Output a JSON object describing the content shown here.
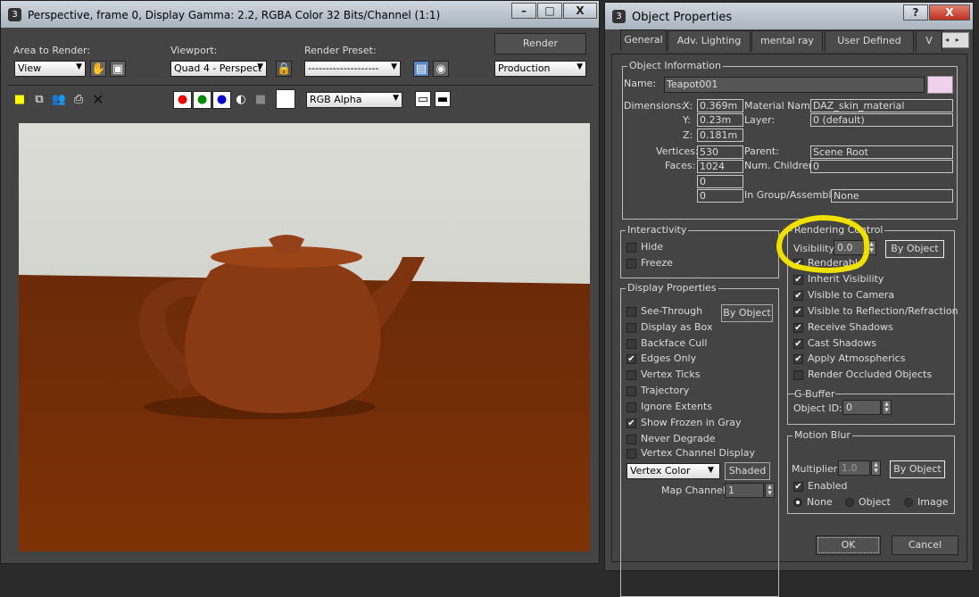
{
  "render_window": {
    "title": "Perspective, frame 0, Display Gamma: 2.2, RGBA Color 32 Bits/Channel (1:1)",
    "area_to_render_label": "Area to Render:",
    "area_to_render_value": "View",
    "viewport_label": "Viewport:",
    "viewport_value": "Quad 4 - Perspect",
    "render_preset_label": "Render Preset:",
    "render_preset_value": "--------------------",
    "render_button": "Render",
    "render_mode_value": "Production",
    "channel_value": "RGB Alpha",
    "colors": {
      "floor": "#7a2e06",
      "background": "#d8d8d2",
      "teapot": "#8a3a12"
    }
  },
  "dialog": {
    "title": "Object Properties",
    "tabs": [
      "General",
      "Adv. Lighting",
      "mental ray",
      "User Defined",
      "V"
    ],
    "object_info": {
      "title": "Object Information",
      "name_label": "Name:",
      "name_value": "Teapot001",
      "color_swatch": "#f0d0ec",
      "dimensions_label": "Dimensions:",
      "x_label": "X:",
      "x": "0.369m",
      "y_label": "Y:",
      "y": "0.23m",
      "z_label": "Z:",
      "z": "0.181m",
      "vertices_label": "Vertices:",
      "vertices": "530",
      "faces_label": "Faces:",
      "faces": "1024",
      "extra1": "0",
      "extra2": "0",
      "material_label": "Material Name:",
      "material": "DAZ_skin_material",
      "layer_label": "Layer:",
      "layer": "0 (default)",
      "parent_label": "Parent:",
      "parent": "Scene Root",
      "children_label": "Num. Children:",
      "children": "0",
      "group_label": "In Group/Assembly:",
      "group": "None"
    },
    "interactivity": {
      "title": "Interactivity",
      "items": [
        {
          "label": "Hide",
          "checked": false
        },
        {
          "label": "Freeze",
          "checked": false
        }
      ]
    },
    "display_properties": {
      "title": "Display Properties",
      "by_object": "By Object",
      "items": [
        {
          "label": "See-Through",
          "checked": false
        },
        {
          "label": "Display as Box",
          "checked": false
        },
        {
          "label": "Backface Cull",
          "checked": false
        },
        {
          "label": "Edges Only",
          "checked": true
        },
        {
          "label": "Vertex Ticks",
          "checked": false
        },
        {
          "label": "Trajectory",
          "checked": false
        },
        {
          "label": "Ignore Extents",
          "checked": false
        },
        {
          "label": "Show Frozen in Gray",
          "checked": true
        },
        {
          "label": "Never Degrade",
          "checked": false
        },
        {
          "label": "Vertex Channel Display",
          "checked": false
        }
      ],
      "vertex_color_value": "Vertex Color",
      "shaded_button": "Shaded",
      "map_channel_label": "Map Channel:",
      "map_channel": "1"
    },
    "rendering_control": {
      "title": "Rendering Control",
      "visibility_label": "Visibility:",
      "visibility": "0.0",
      "by_object": "By Object",
      "items": [
        {
          "label": "Renderable",
          "checked": true
        },
        {
          "label": "Inherit Visibility",
          "checked": true
        },
        {
          "label": "Visible to Camera",
          "checked": true
        },
        {
          "label": "Visible to Reflection/Refraction",
          "checked": true
        },
        {
          "label": "Receive Shadows",
          "checked": true
        },
        {
          "label": "Cast Shadows",
          "checked": true
        },
        {
          "label": "Apply Atmospherics",
          "checked": true
        },
        {
          "label": "Render Occluded Objects",
          "checked": false
        }
      ],
      "highlight_color": "#f0e000"
    },
    "gbuffer": {
      "title": "G-Buffer",
      "object_id_label": "Object ID:",
      "object_id": "0"
    },
    "motion_blur": {
      "title": "Motion Blur",
      "multiplier_label": "Multiplier:",
      "multiplier": "1.0",
      "by_object": "By Object",
      "enabled_label": "Enabled",
      "enabled": true,
      "options": [
        {
          "label": "None",
          "selected": true
        },
        {
          "label": "Object",
          "selected": false
        },
        {
          "label": "Image",
          "selected": false
        }
      ]
    },
    "ok": "OK",
    "cancel": "Cancel"
  }
}
